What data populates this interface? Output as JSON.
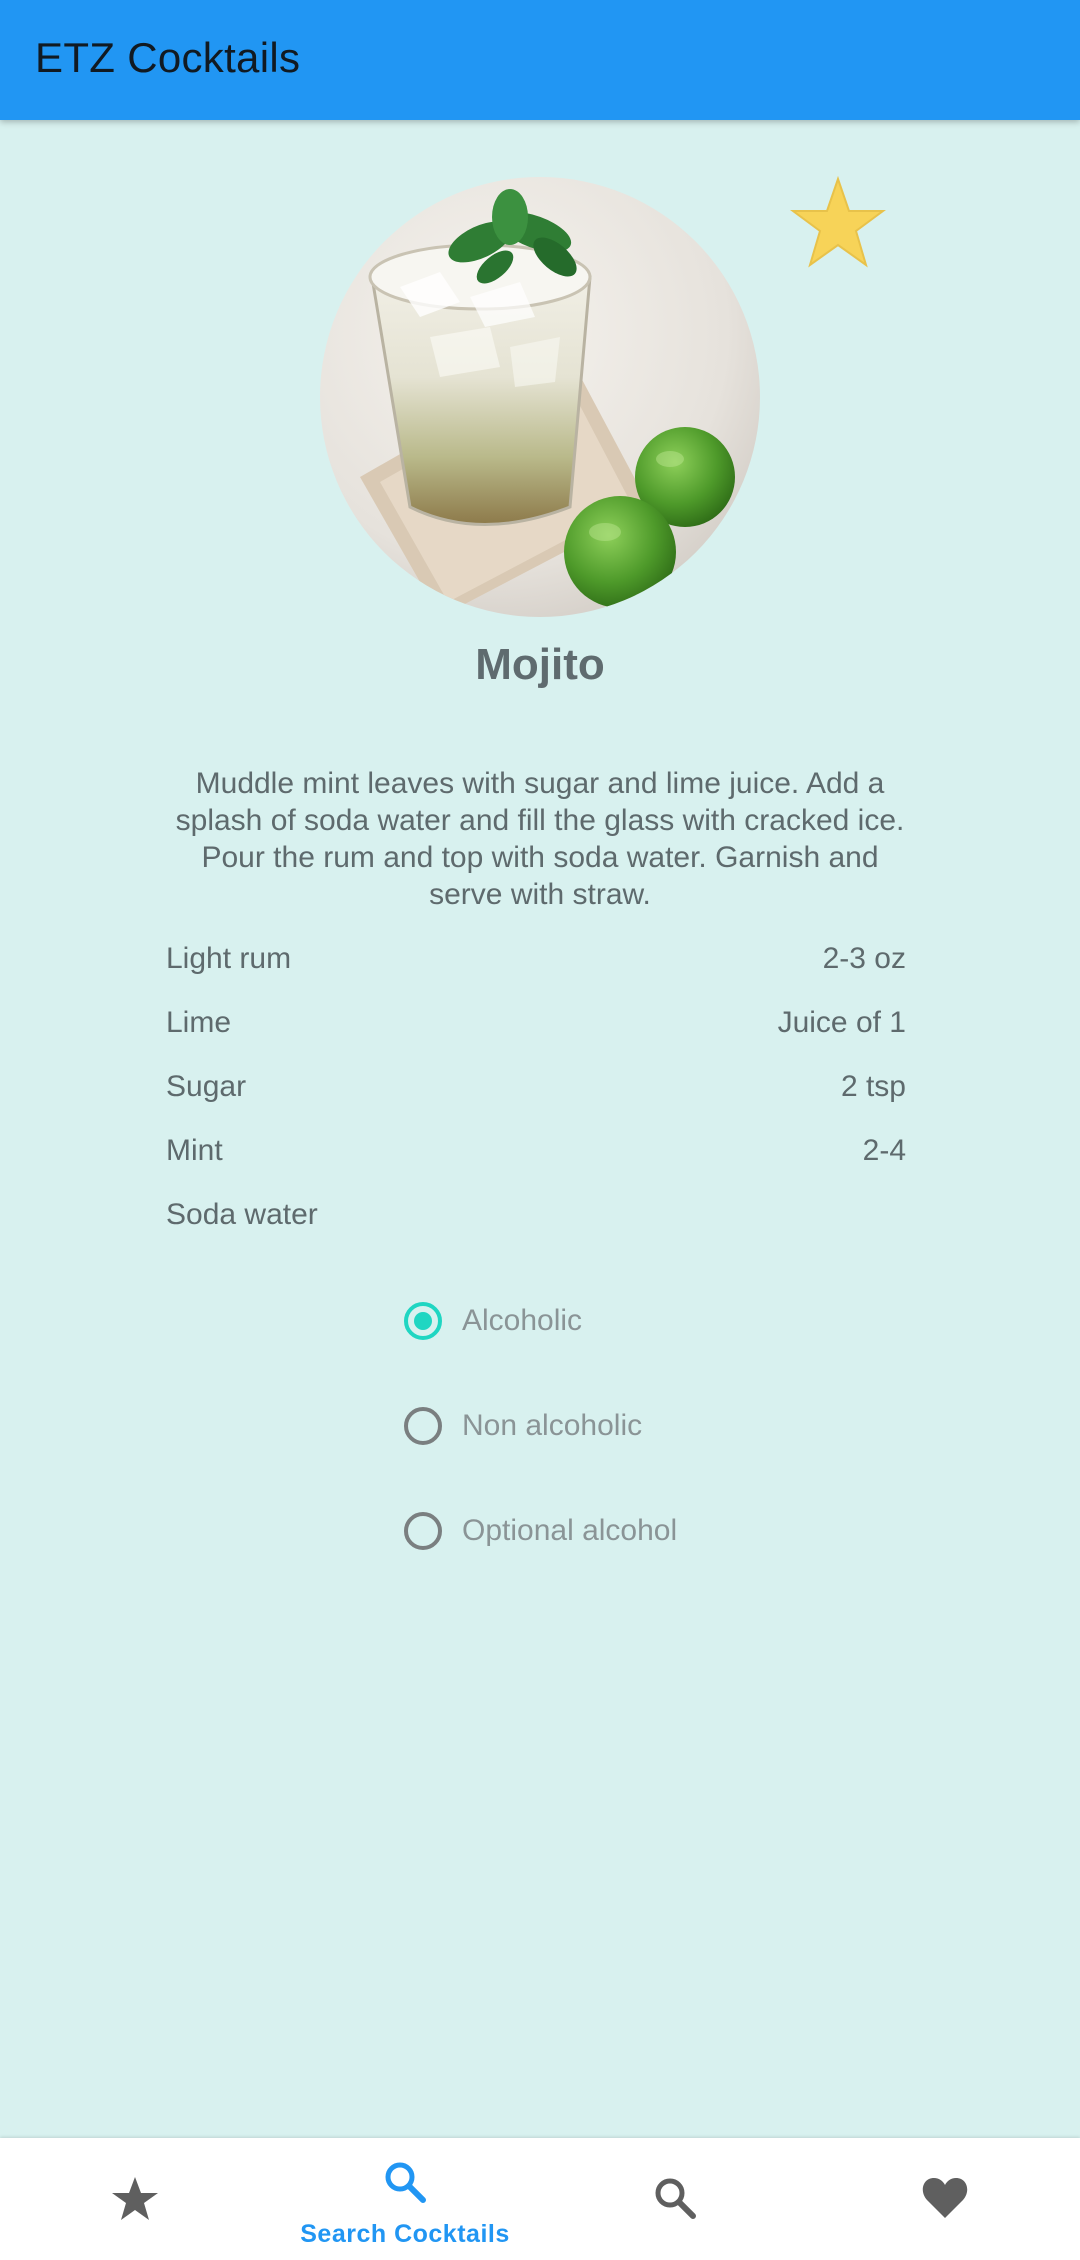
{
  "app": {
    "title": "ETZ Cocktails",
    "accent_color": "#2196f3",
    "background_color": "#d8f1ef"
  },
  "cocktail": {
    "name": "Mojito",
    "image_icon": "cocktail-photo",
    "favorite_icon": "star-icon",
    "favorite_color": "#f7d358",
    "instructions": "Muddle mint leaves with sugar and lime juice. Add a splash of soda water and fill the glass with cracked ice. Pour the rum and top with soda water. Garnish and serve with straw.",
    "ingredients": [
      {
        "name": "Light rum",
        "measure": "2-3 oz"
      },
      {
        "name": "Lime",
        "measure": "Juice of 1"
      },
      {
        "name": "Sugar",
        "measure": "2 tsp"
      },
      {
        "name": "Mint",
        "measure": "2-4"
      },
      {
        "name": "Soda water",
        "measure": ""
      }
    ]
  },
  "alcohol_filter": {
    "selected": "Alcoholic",
    "selected_color": "#1fd6c2",
    "options": [
      {
        "label": "Alcoholic",
        "selected": true
      },
      {
        "label": "Non alcoholic",
        "selected": false
      },
      {
        "label": "Optional alcohol",
        "selected": false
      }
    ]
  },
  "bottom_nav": {
    "items": [
      {
        "icon": "star-icon",
        "label": "",
        "active": false
      },
      {
        "icon": "search-icon",
        "label": "Search Cocktails",
        "active": true
      },
      {
        "icon": "search-icon",
        "label": "",
        "active": false
      },
      {
        "icon": "heart-icon",
        "label": "",
        "active": false
      }
    ]
  }
}
